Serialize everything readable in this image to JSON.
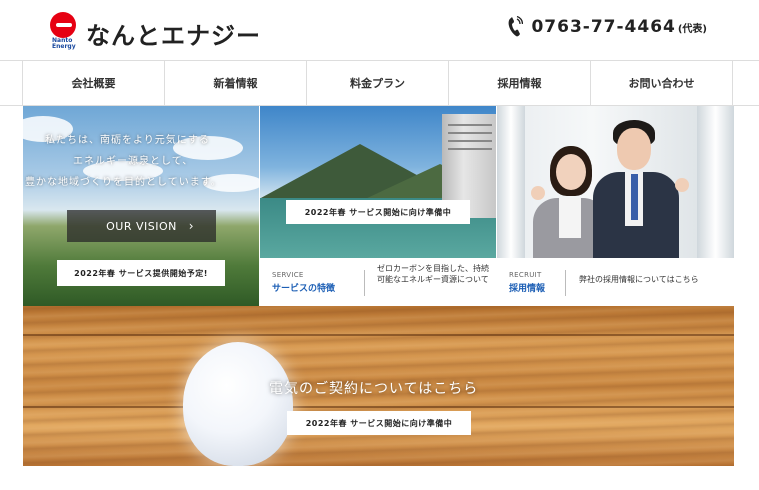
{
  "header": {
    "logo_text": "なんとエナジー",
    "logo_sub_1": "Nanto",
    "logo_sub_2": "Energy",
    "phone_number": "0763-77-4464",
    "phone_note": "(代表)"
  },
  "nav": {
    "items": [
      {
        "label": "会社概要"
      },
      {
        "label": "新着情報"
      },
      {
        "label": "料金プラン"
      },
      {
        "label": "採用情報"
      },
      {
        "label": "お問い合わせ"
      }
    ]
  },
  "vision": {
    "line1": "私たちは、南砺をより元気にする",
    "line2": "エネルギー源泉として、",
    "line3": "豊かな地域づくりを目的としています。",
    "button_label": "OUR VISION",
    "badge": "2022年春 サービス提供開始予定!"
  },
  "service": {
    "badge": "2022年春 サービス開始に向け準備中",
    "category": "SERVICE",
    "title": "サービスの特徴",
    "description": "ゼロカーボンを目指した、持続可能なエネルギー資源について"
  },
  "recruit": {
    "category": "RECRUIT",
    "title": "採用情報",
    "description": "弊社の採用情報についてはこちら"
  },
  "contract": {
    "title": "電気のご契約についてはこちら",
    "badge": "2022年春 サービス開始に向け準備中"
  },
  "icons": {
    "phone": "phone-icon",
    "chevron": "chevron-right-icon"
  },
  "colors": {
    "brand_red": "#e60012",
    "link_blue": "#1d5fb5"
  }
}
